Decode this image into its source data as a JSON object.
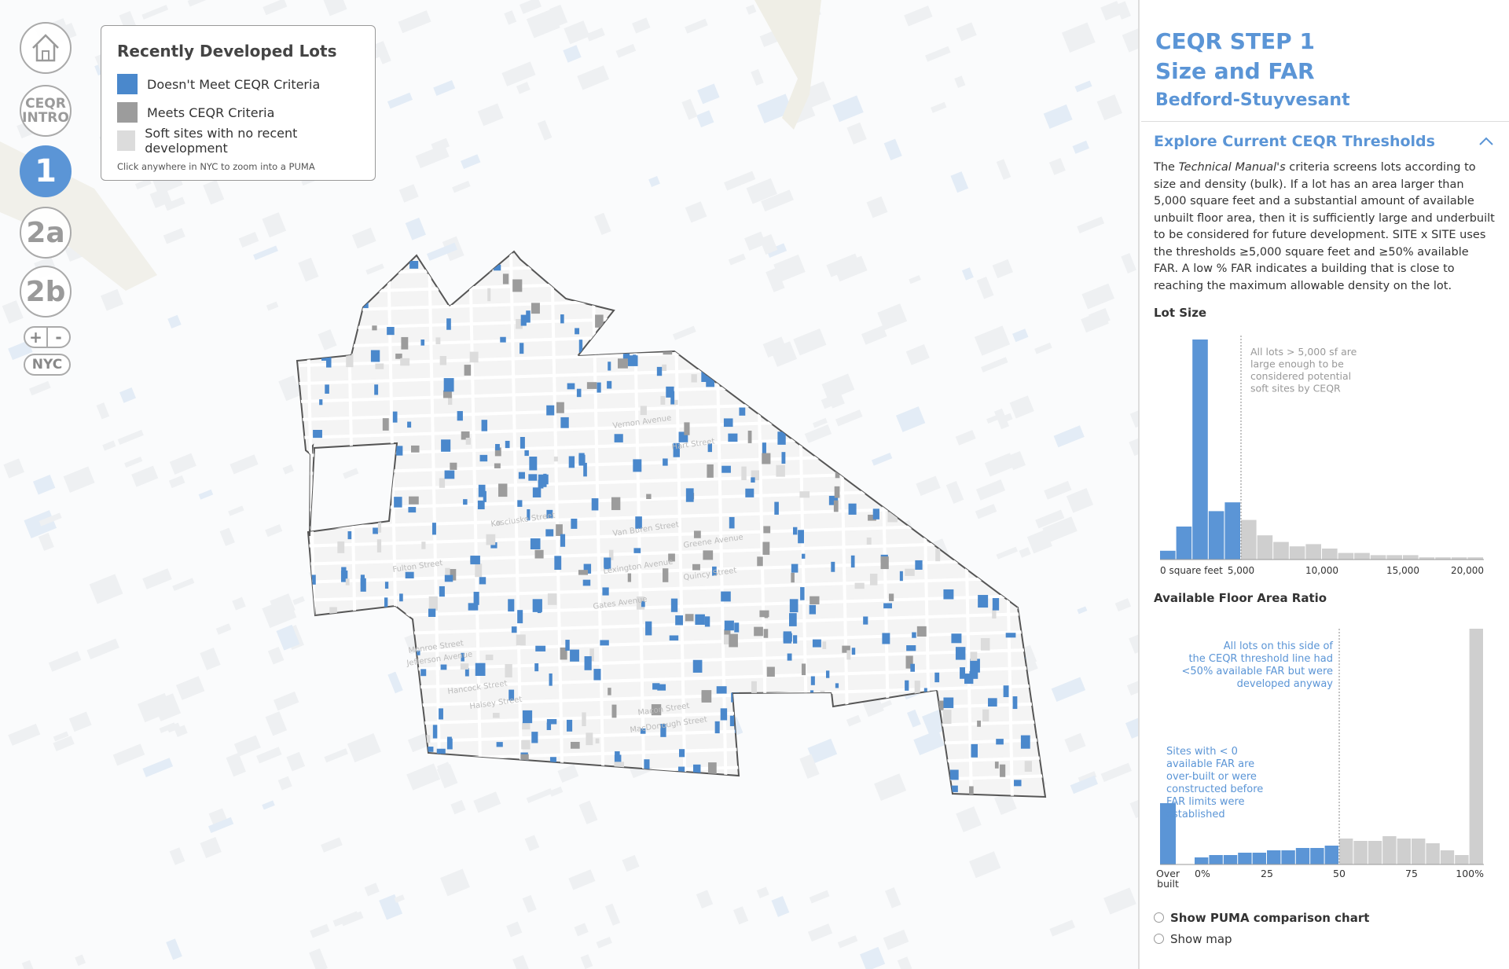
{
  "nav": {
    "home_icon": "home-icon",
    "intro_line1": "CEQR",
    "intro_line2": "INTRO",
    "step1": "1",
    "step2a": "2a",
    "step2b": "2b",
    "zoom_in": "+",
    "zoom_out": "-",
    "nyc": "NYC"
  },
  "legend": {
    "title": "Recently Developed Lots",
    "items": [
      {
        "label": "Doesn't Meet CEQR Criteria",
        "color": "#4a88cc"
      },
      {
        "label": "Meets CEQR Criteria",
        "color": "#9c9c9c"
      },
      {
        "label": "Soft sites with no recent development",
        "color": "#dcdcdc"
      }
    ],
    "hint": "Click anywhere in NYC to zoom into a PUMA"
  },
  "panel": {
    "title_line1": "CEQR STEP 1",
    "title_line2": "Size and FAR",
    "subtitle": "Bedford-Stuyvesant",
    "section_title": "Explore Current CEQR Thresholds",
    "body_pre": "The ",
    "body_italic": "Technical Manual's",
    "body_post": " criteria screens lots according to size and density (bulk). If a lot has an area larger than 5,000 square feet and a substantial amount of available unbuilt floor area, then it is sufficiently large and underbuilt to be considered for future development. SITE x SITE uses the thresholds ≥5,000 square feet and ≥50% available FAR. A low % FAR indicates a building that is close to reaching the maximum allowable density on the lot.",
    "lot_size_title": "Lot Size",
    "far_title": "Available Floor Area Ratio",
    "option1": "Show PUMA comparison chart",
    "option2": "Show map"
  },
  "chart_data": [
    {
      "type": "bar",
      "title": "Lot Size",
      "x_ticks": [
        "0 square feet",
        "5,000",
        "10,000",
        "15,000",
        "20,000"
      ],
      "xlim": [
        0,
        20000
      ],
      "bin_width": 1000,
      "values": [
        4,
        15,
        100,
        22,
        26,
        18,
        11,
        8,
        6,
        7,
        5,
        3,
        3,
        2,
        2,
        2,
        1,
        1,
        1,
        1
      ],
      "highlight_color": "#5b95d6",
      "base_color": "#cfcfcf",
      "threshold": 5000,
      "annotation": "All lots > 5,000 sf are large enough to be considered potential soft sites by CEQR"
    },
    {
      "type": "bar",
      "title": "Available Floor Area Ratio",
      "overbuilt_label": "Over built",
      "overbuilt_value": 26,
      "x_ticks": [
        "0%",
        "25",
        "50",
        "75",
        "100%"
      ],
      "xlim": [
        0,
        100
      ],
      "bin_width": 5,
      "values": [
        3,
        4,
        4,
        5,
        5,
        6,
        6,
        7,
        7,
        8,
        11,
        10,
        10,
        12,
        11,
        11,
        9,
        6,
        4,
        100
      ],
      "highlight_color": "#5b95d6",
      "base_color": "#cfcfcf",
      "threshold": 50,
      "annotation_left": "All lots on this side of the CEQR threshold line had <50% available FAR but were developed anyway",
      "annotation_overbuilt": "Sites with < 0 available FAR are over-built or were constructed before FAR limits were established"
    }
  ],
  "streets": [
    "Vernon Avenue",
    "Hart Street",
    "Kosciusko Street",
    "Van Buren Street",
    "Greene Avenue",
    "Lexington Avenue",
    "Quincy Street",
    "Gates Avenue",
    "Fulton Street",
    "Monroe Street",
    "Jefferson Avenue",
    "Hancock Street",
    "Halsey Street",
    "Macon Street",
    "MacDonough Street"
  ]
}
